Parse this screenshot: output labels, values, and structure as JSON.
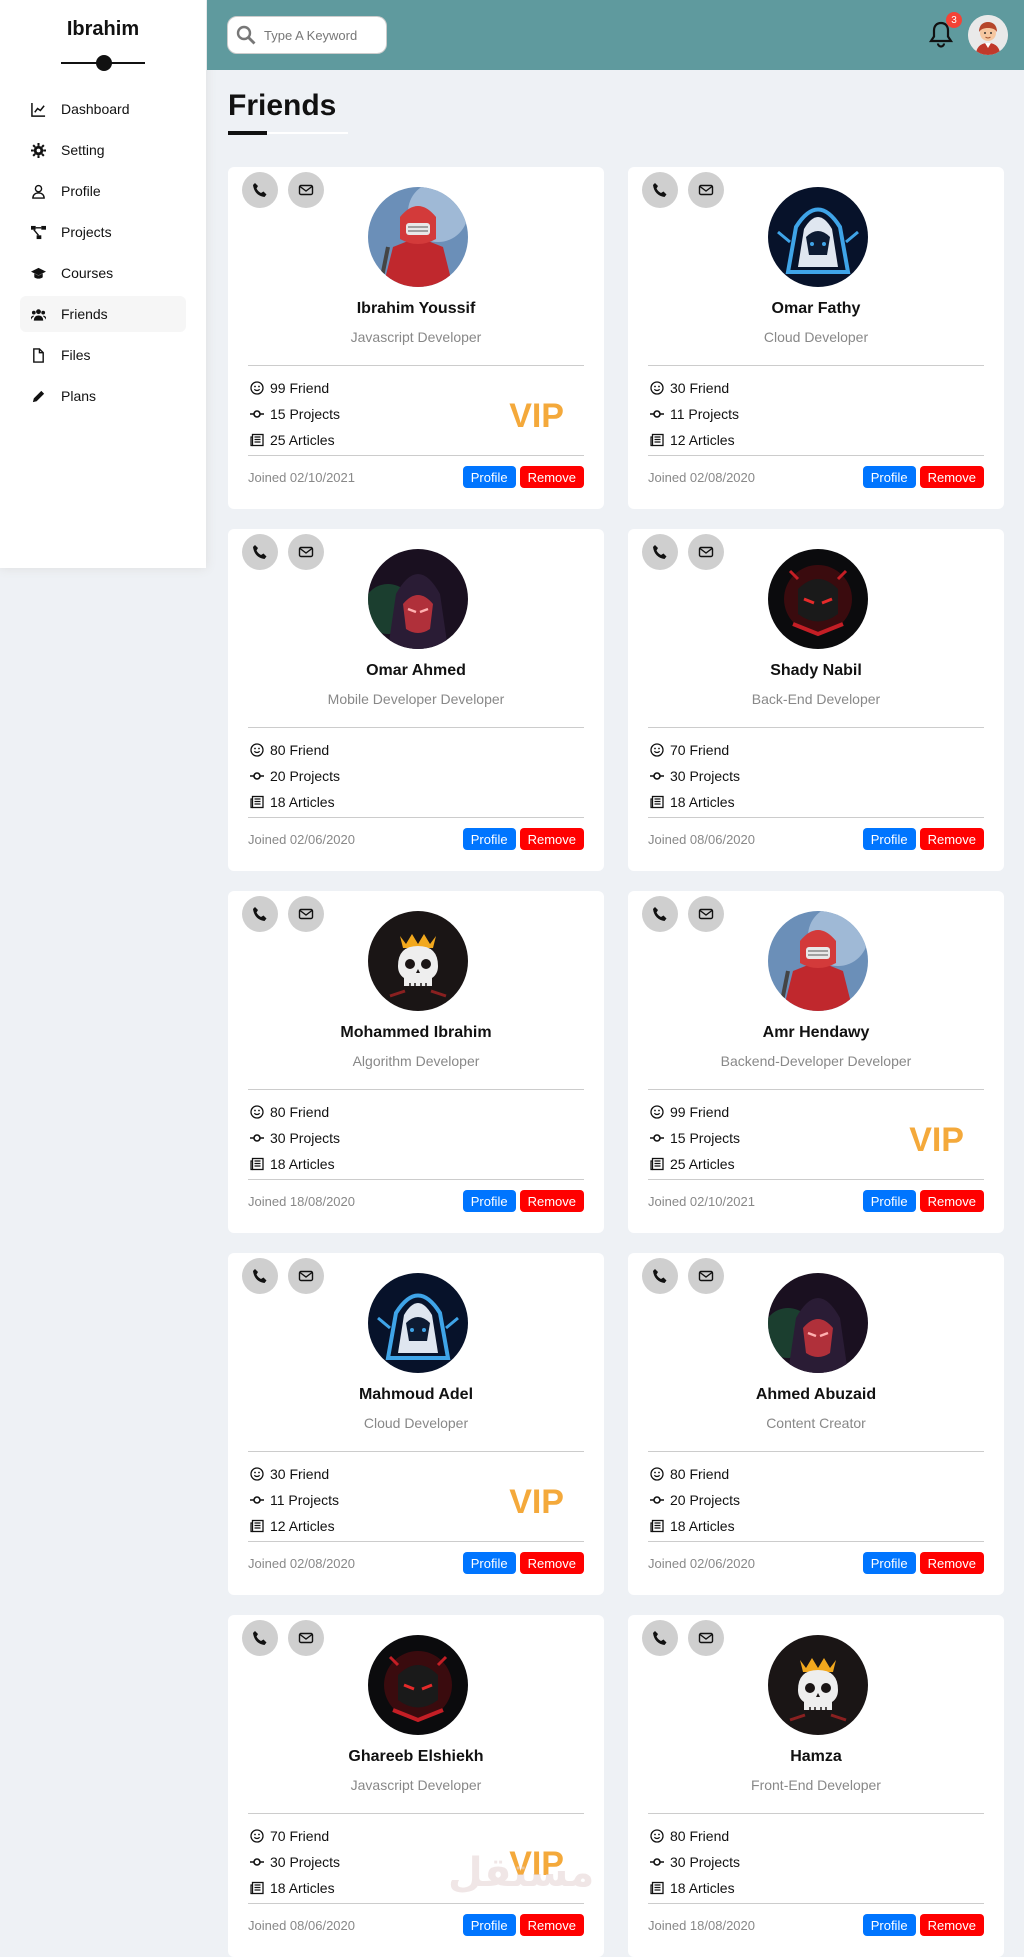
{
  "sidebar": {
    "brand": "Ibrahim",
    "items": [
      {
        "label": "Dashboard",
        "icon": "chart-line-icon"
      },
      {
        "label": "Setting",
        "icon": "gear-icon"
      },
      {
        "label": "Profile",
        "icon": "user-icon"
      },
      {
        "label": "Projects",
        "icon": "diagram-icon"
      },
      {
        "label": "Courses",
        "icon": "graduation-cap-icon"
      },
      {
        "label": "Friends",
        "icon": "users-icon"
      },
      {
        "label": "Files",
        "icon": "file-icon"
      },
      {
        "label": "Plans",
        "icon": "pencil-icon"
      }
    ]
  },
  "header": {
    "search_placeholder": "Type A Keyword",
    "notification_count": "3"
  },
  "page": {
    "title": "Friends"
  },
  "cards": [
    {
      "name": "Ibrahim Youssif",
      "job": "Javascript Developer",
      "friends": "99 Friend",
      "projects": "15 Projects",
      "articles": "25 Articles",
      "vip": "VIP",
      "joined": "Joined 02/10/2021",
      "profile": "Profile",
      "remove": "Remove"
    },
    {
      "name": "Omar Fathy",
      "job": "Cloud Developer",
      "friends": "30 Friend",
      "projects": "11 Projects",
      "articles": "12 Articles",
      "vip": "",
      "joined": "Joined 02/08/2020",
      "profile": "Profile",
      "remove": "Remove"
    },
    {
      "name": "Omar Ahmed",
      "job": "Mobile Developer Developer",
      "friends": "80 Friend",
      "projects": "20 Projects",
      "articles": "18 Articles",
      "vip": "",
      "joined": "Joined 02/06/2020",
      "profile": "Profile",
      "remove": "Remove"
    },
    {
      "name": "Shady Nabil",
      "job": "Back-End Developer",
      "friends": "70 Friend",
      "projects": "30 Projects",
      "articles": "18 Articles",
      "vip": "",
      "joined": "Joined 08/06/2020",
      "profile": "Profile",
      "remove": "Remove"
    },
    {
      "name": "Mohammed Ibrahim",
      "job": "Algorithm Developer",
      "friends": "80 Friend",
      "projects": "30 Projects",
      "articles": "18 Articles",
      "vip": "",
      "joined": "Joined 18/08/2020",
      "profile": "Profile",
      "remove": "Remove"
    },
    {
      "name": "Amr Hendawy",
      "job": "Backend-Developer Developer",
      "friends": "99 Friend",
      "projects": "15 Projects",
      "articles": "25 Articles",
      "vip": "VIP",
      "joined": "Joined 02/10/2021",
      "profile": "Profile",
      "remove": "Remove"
    },
    {
      "name": "Mahmoud Adel",
      "job": "Cloud Developer",
      "friends": "30 Friend",
      "projects": "11 Projects",
      "articles": "12 Articles",
      "vip": "VIP",
      "joined": "Joined 02/08/2020",
      "profile": "Profile",
      "remove": "Remove"
    },
    {
      "name": "Ahmed Abuzaid",
      "job": "Content Creator",
      "friends": "80 Friend",
      "projects": "20 Projects",
      "articles": "18 Articles",
      "vip": "",
      "joined": "Joined 02/06/2020",
      "profile": "Profile",
      "remove": "Remove"
    },
    {
      "name": "Ghareeb Elshiekh",
      "job": "Javascript Developer",
      "friends": "70 Friend",
      "projects": "30 Projects",
      "articles": "18 Articles",
      "vip": "VIP",
      "joined": "Joined 08/06/2020",
      "profile": "Profile",
      "remove": "Remove"
    },
    {
      "name": "Hamza",
      "job": "Front-End Developer",
      "friends": "80 Friend",
      "projects": "30 Projects",
      "articles": "18 Articles",
      "vip": "",
      "joined": "Joined 18/08/2020",
      "profile": "Profile",
      "remove": "Remove"
    }
  ],
  "watermark": "مستقل",
  "colors": {
    "header": "#5f9a9e",
    "profile_button": "#0075ff",
    "remove_button": "#ff0000",
    "vip": "#f4a93b",
    "background": "#eef1f5"
  }
}
